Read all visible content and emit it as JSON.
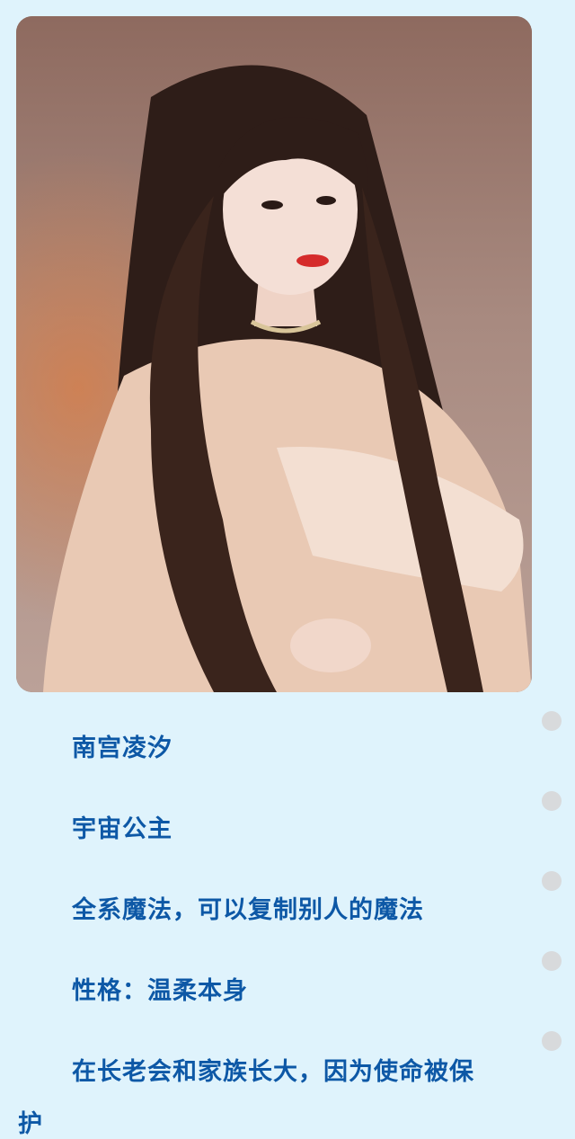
{
  "profile": {
    "name": "南宫凌汐",
    "title": "宇宙公主",
    "ability": "全系魔法，可以复制别人的魔法",
    "personality": "性格：温柔本身",
    "background_line1": "在长老会和家族长大，因为使命被保",
    "background_line2": "护"
  },
  "colors": {
    "background": "#dff3fc",
    "text": "#0d58a6",
    "dot": "#d8dadc"
  }
}
